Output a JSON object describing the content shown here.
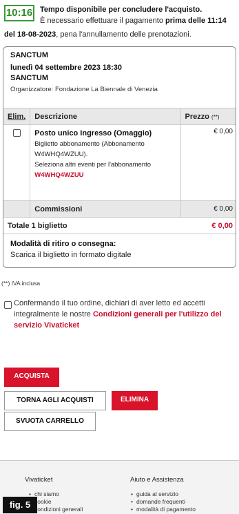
{
  "timer": {
    "value": "10:16",
    "title": "Tempo disponibile per concludere l'acquisto.",
    "line1_prefix": "È necessario effettuare il pagamento",
    "line1_bold": "prima delle 11:14",
    "line2_bold": "del 18-08-2023",
    "line2_suffix": ", pena l'annullamento delle prenotazioni."
  },
  "event": {
    "name": "SANCTUM",
    "date": "lunedì 04 settembre 2023 18:30",
    "subtitle": "SANCTUM",
    "organizer": "Organizzatore: Fondazione La Biennale di Venezia"
  },
  "table": {
    "col_elim": "Elim.",
    "col_desc": "Descrizione",
    "col_price": "Prezzo",
    "col_price_note": "(**)",
    "item": {
      "name": "Posto unico Ingresso (Omaggio)",
      "desc1": "Biglietto abbonamento (Abbonamento",
      "desc2": "W4WHQ4WZUU).",
      "desc3": "Seleziona altri eventi per l'abbonamento",
      "code": "W4WHQ4WZUU",
      "price": "€ 0,00"
    },
    "commission_label": "Commissioni",
    "commission_price": "€ 0,00",
    "total_label": "Totale 1 biglietto",
    "total_price": "€ 0,00"
  },
  "delivery": {
    "title": "Modalità di ritiro o consegna:",
    "value": "Scarica il biglietto in formato digitale"
  },
  "iva_note": "(**) IVA inclusa",
  "agree": {
    "text": "Confermando il tuo ordine, dichiari di aver letto ed accetti integralmente le nostre",
    "link": "Condizioni generali per l'utilizzo del servizio Vivaticket"
  },
  "buttons": {
    "buy": "ACQUISTA",
    "back": "TORNA AGLI ACQUISTI",
    "delete": "ELIMINA",
    "empty": "SVUOTA CARRELLO"
  },
  "footer": {
    "col1_title": "Vivaticket",
    "col1_items": [
      "chi siamo",
      "cookie",
      "condizioni generali"
    ],
    "col2_title": "Aiuto e Assistenza",
    "col2_items": [
      "guida al servizio",
      "domande frequenti",
      "modalità di pagamento"
    ]
  },
  "fig_label": "fig. 5"
}
